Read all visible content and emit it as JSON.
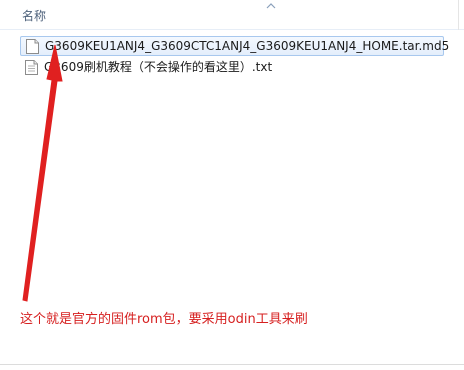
{
  "header": {
    "name_column": "名称"
  },
  "files": [
    {
      "name": "G3609KEU1ANJ4_G3609CTC1ANJ4_G3609KEU1ANJ4_HOME.tar.md5",
      "icon": "document-icon",
      "selected": true
    },
    {
      "name": "G3609刷机教程（不会操作的看这里）.txt",
      "icon": "text-file-icon",
      "selected": false
    }
  ],
  "annotation": {
    "text": "这个就是官方的固件rom包，要采用odin工具来刷",
    "color": "#d62020"
  },
  "colors": {
    "selection_border": "#a8c8ee",
    "header_text": "#4c607a",
    "arrow": "#e02020"
  }
}
